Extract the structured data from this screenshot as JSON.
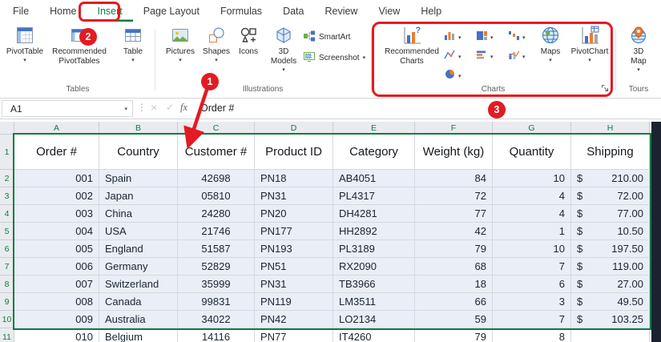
{
  "colors": {
    "excel_green": "#107C41",
    "annotation_red": "#E31B22",
    "selection_fill": "#EAEEF6",
    "header_fill": "#E9EBEE",
    "dark_edge": "#1B2330"
  },
  "menu": {
    "tabs": [
      {
        "label": "File",
        "active": false
      },
      {
        "label": "Home",
        "active": false
      },
      {
        "label": "Insert",
        "active": true
      },
      {
        "label": "Page Layout",
        "active": false
      },
      {
        "label": "Formulas",
        "active": false
      },
      {
        "label": "Data",
        "active": false
      },
      {
        "label": "Review",
        "active": false
      },
      {
        "label": "View",
        "active": false
      },
      {
        "label": "Help",
        "active": false
      }
    ]
  },
  "ribbon": {
    "tables": {
      "label": "Tables",
      "pivottable": "PivotTable",
      "recommended_pivottables": "Recommended PivotTables",
      "table": "Table"
    },
    "illustrations": {
      "label": "Illustrations",
      "pictures": "Pictures",
      "shapes": "Shapes",
      "icons": "Icons",
      "models_3d": "3D Models",
      "smartart": "SmartArt",
      "screenshot": "Screenshot"
    },
    "charts": {
      "label": "Charts",
      "recommended_charts": "Recommended Charts",
      "maps": "Maps",
      "pivotchart": "PivotChart",
      "mini_buttons": [
        "column-chart",
        "hierarchy-chart",
        "waterfall-chart",
        "line-chart",
        "bar-chart",
        "combo-chart",
        "pie-chart"
      ]
    },
    "tours": {
      "label": "Tours",
      "map_3d": "3D Map"
    }
  },
  "formula_bar": {
    "name_box": "A1",
    "content": "Order #"
  },
  "icons": {
    "chevron": "▾",
    "dots": "⋮",
    "cancel": "×",
    "enter": "✓",
    "fx": "fx"
  },
  "annotations": {
    "step_1": "1",
    "step_2": "2",
    "step_3": "3"
  },
  "spreadsheet": {
    "currency": "$",
    "col_headers": [
      "A",
      "B",
      "C",
      "D",
      "E",
      "F",
      "G",
      "H"
    ],
    "row_headers": [
      "1",
      "2",
      "3",
      "4",
      "5",
      "6",
      "7",
      "8",
      "9",
      "10",
      "11"
    ],
    "header_row": [
      "Order #",
      "Country",
      "Customer #",
      "Product ID",
      "Category",
      "Weight (kg)",
      "Quantity",
      "Shipping"
    ],
    "rows": [
      [
        "001",
        "Spain",
        "42698",
        "PN18",
        "AB4051",
        "84",
        "10",
        "210.00"
      ],
      [
        "002",
        "Japan",
        "05810",
        "PN31",
        "PL4317",
        "72",
        "4",
        "72.00"
      ],
      [
        "003",
        "China",
        "24280",
        "PN20",
        "DH4281",
        "77",
        "4",
        "77.00"
      ],
      [
        "004",
        "USA",
        "21746",
        "PN177",
        "HH2892",
        "42",
        "1",
        "10.50"
      ],
      [
        "005",
        "England",
        "51587",
        "PN193",
        "PL3189",
        "79",
        "10",
        "197.50"
      ],
      [
        "006",
        "Germany",
        "52829",
        "PN51",
        "RX2090",
        "68",
        "7",
        "119.00"
      ],
      [
        "007",
        "Switzerland",
        "35999",
        "PN31",
        "TB3966",
        "18",
        "6",
        "27.00"
      ],
      [
        "008",
        "Canada",
        "99831",
        "PN119",
        "LM3511",
        "66",
        "3",
        "49.50"
      ],
      [
        "009",
        "Australia",
        "34022",
        "PN42",
        "LO2134",
        "59",
        "7",
        "103.25"
      ],
      [
        "010",
        "Belgium",
        "14116",
        "PN77",
        "IT4260",
        "79",
        "8",
        ""
      ]
    ]
  }
}
